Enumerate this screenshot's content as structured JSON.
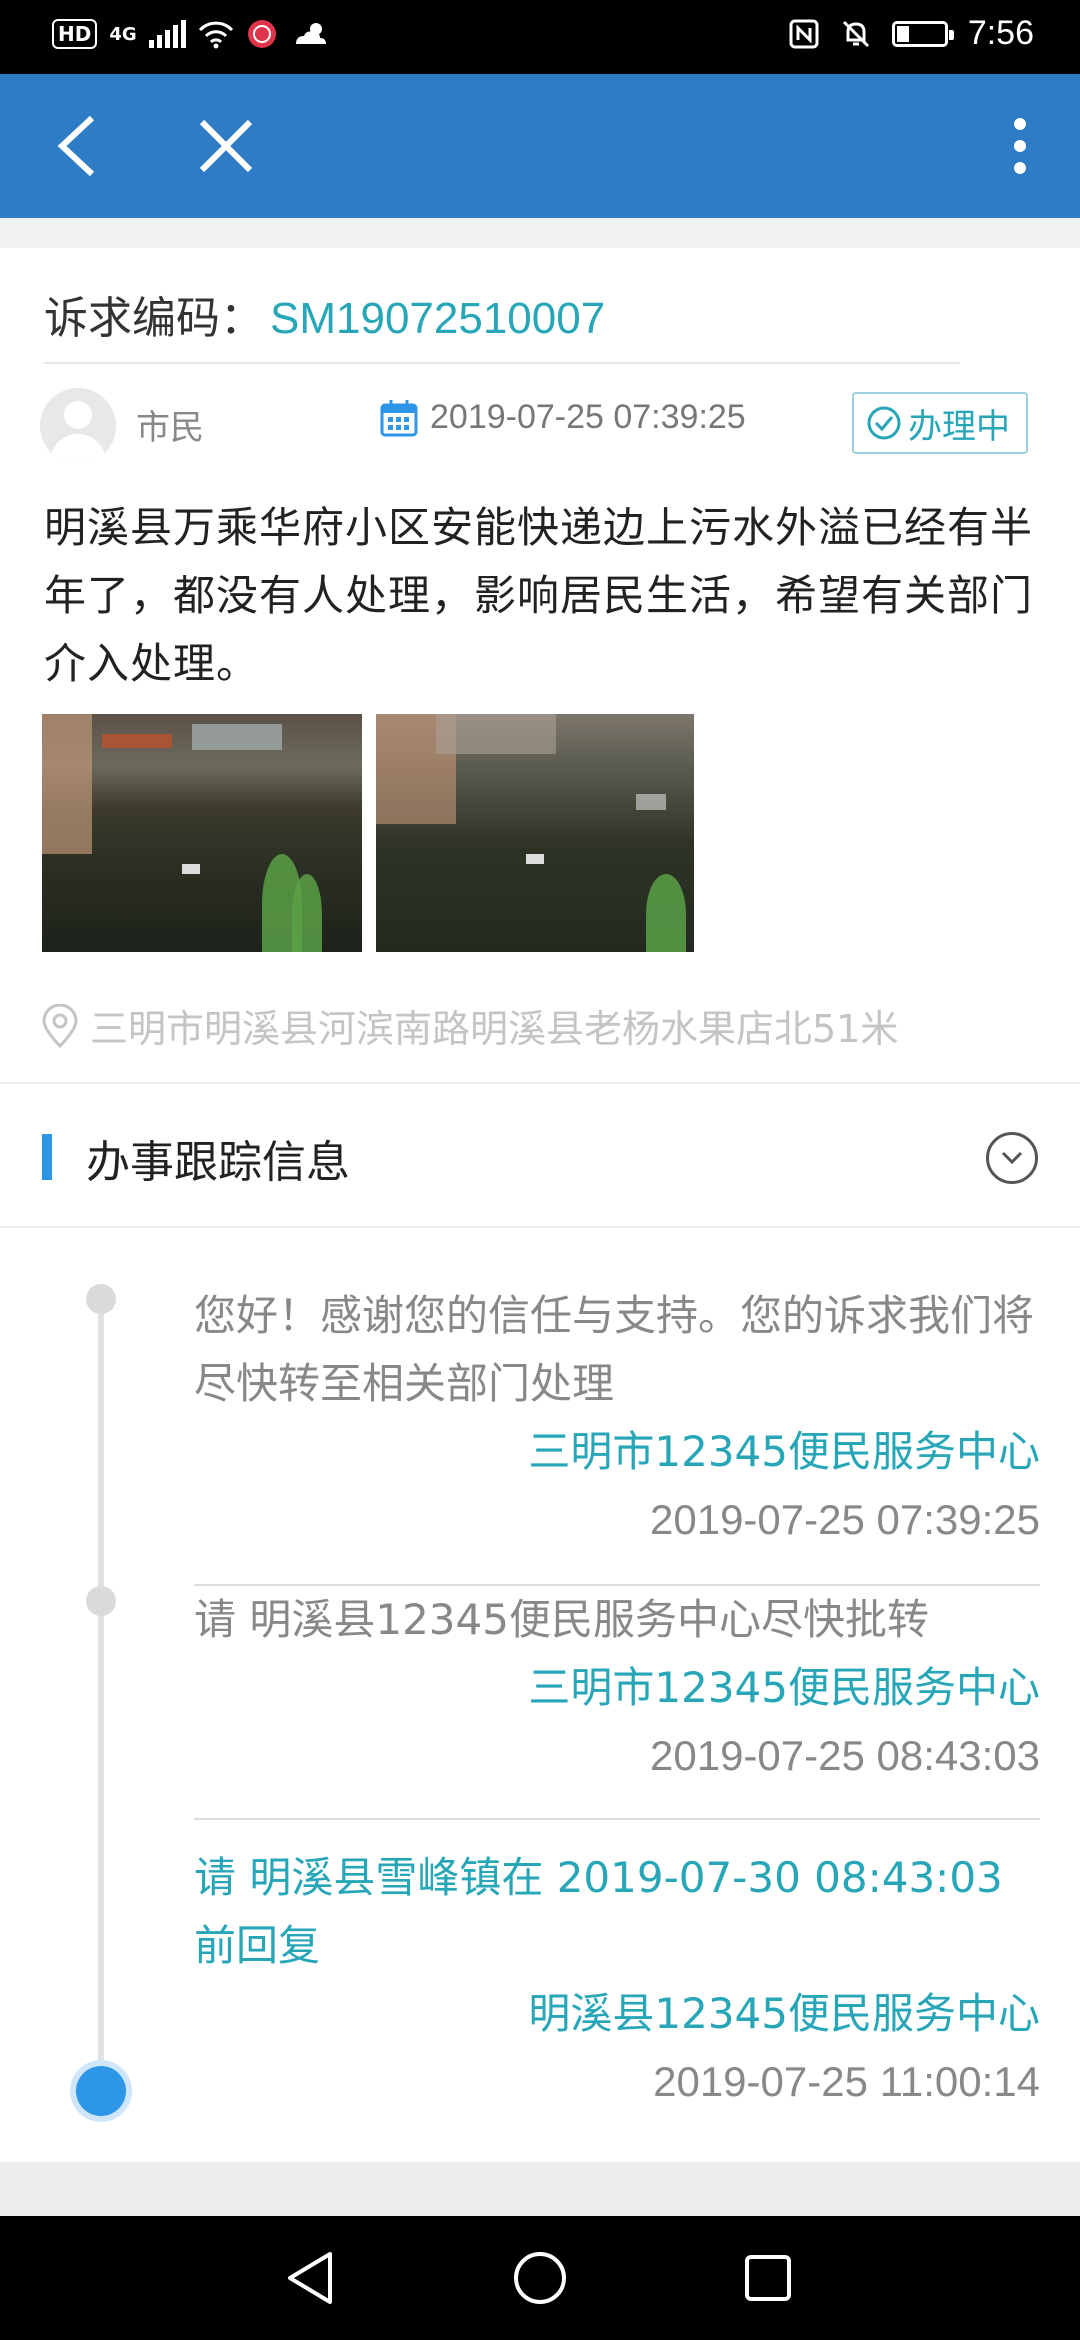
{
  "status_bar": {
    "hd": "HD",
    "network": "4G",
    "time": "7:56",
    "battery_level": 0.25
  },
  "app_bar": {
    "back_icon": "chevron-left-icon",
    "close_icon": "close-icon",
    "more_icon": "more-vertical-icon"
  },
  "appeal": {
    "code_label": "诉求编码：",
    "code_value": "SM19072510007",
    "user_role": "市民",
    "date": "2019-07-25 07:39:25",
    "status": "办理中",
    "description": "明溪县万乘华府小区安能快递边上污水外溢已经有半年了，都没有人处理，影响居民生活，希望有关部门介入处理。",
    "address": "三明市明溪县河滨南路明溪县老杨水果店北51米"
  },
  "tracking": {
    "title": "办事跟踪信息",
    "items": [
      {
        "message": "您好！感谢您的信任与支持。您的诉求我们将尽快转至相关部门处理",
        "org": "三明市12345便民服务中心",
        "time": "2019-07-25 07:39:25"
      },
      {
        "message": "请 明溪县12345便民服务中心尽快批转",
        "org": "三明市12345便民服务中心",
        "time": "2019-07-25 08:43:03"
      },
      {
        "message": "请 明溪县雪峰镇在 2019-07-30 08:43:03 前回复",
        "org": "明溪县12345便民服务中心",
        "time": "2019-07-25 11:00:14"
      }
    ]
  },
  "colors": {
    "app_bar": "#2e7cc6",
    "accent_teal": "#27a6b8",
    "timeline_active": "#2e96e6"
  }
}
